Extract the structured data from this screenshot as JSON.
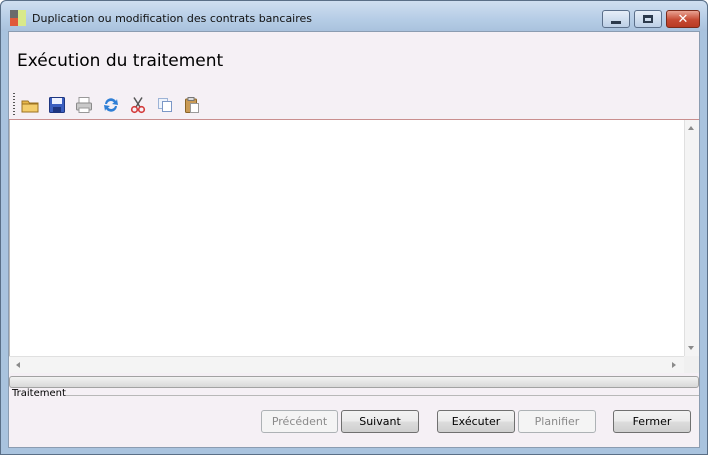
{
  "window": {
    "title": "Duplication ou modification des contrats bancaires",
    "controls": {
      "minimize_icon": "minimize-icon",
      "maximize_icon": "maximize-icon",
      "close_icon": "close-icon"
    }
  },
  "page": {
    "heading": "Exécution du traitement"
  },
  "toolbar": {
    "items": [
      {
        "name": "open",
        "icon": "folder-icon"
      },
      {
        "name": "save",
        "icon": "save-icon"
      },
      {
        "name": "print",
        "icon": "print-icon"
      },
      {
        "name": "refresh",
        "icon": "refresh-icon"
      },
      {
        "name": "cut",
        "icon": "cut-icon"
      },
      {
        "name": "copy",
        "icon": "copy-icon"
      },
      {
        "name": "paste",
        "icon": "paste-icon"
      }
    ]
  },
  "output": {
    "text": ""
  },
  "progress": {
    "value": 0
  },
  "group": {
    "label": "Traitement"
  },
  "buttons": {
    "previous": "Précédent",
    "next": "Suivant",
    "execute": "Exécuter",
    "schedule": "Planifier",
    "close": "Fermer"
  },
  "colors": {
    "accent": "#a9c3de",
    "client_bg": "#f5f0f5",
    "progress_fill": "#37c437"
  }
}
